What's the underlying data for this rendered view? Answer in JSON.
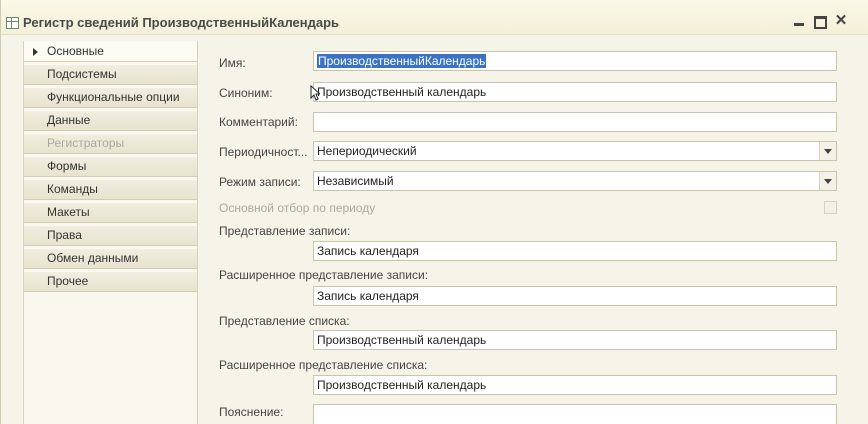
{
  "window": {
    "title": "Регистр сведений ПроизводственныйКалендарь",
    "controls": {
      "minimize": "_",
      "close": "✕"
    }
  },
  "sidebar": {
    "items": [
      {
        "label": "Основные",
        "state": "active"
      },
      {
        "label": "Подсистемы",
        "state": "normal"
      },
      {
        "label": "Функциональные опции",
        "state": "normal"
      },
      {
        "label": "Данные",
        "state": "normal"
      },
      {
        "label": "Регистраторы",
        "state": "disabled"
      },
      {
        "label": "Формы",
        "state": "normal"
      },
      {
        "label": "Команды",
        "state": "normal"
      },
      {
        "label": "Макеты",
        "state": "normal"
      },
      {
        "label": "Права",
        "state": "normal"
      },
      {
        "label": "Обмен данными",
        "state": "normal"
      },
      {
        "label": "Прочее",
        "state": "normal"
      }
    ]
  },
  "form": {
    "name_label": "Имя:",
    "name_value": "ПроизводственныйКалендарь",
    "synonym_label": "Синоним:",
    "synonym_value": "Производственный календарь",
    "comment_label": "Комментарий:",
    "comment_value": "",
    "periodicity_label": "Периодичност...",
    "periodicity_value": "Непериодический",
    "write_mode_label": "Режим записи:",
    "write_mode_value": "Независимый",
    "period_filter_label": "Основной отбор по периоду",
    "period_filter_checked": false,
    "record_presentation_label": "Представление записи:",
    "record_presentation_value": "Запись календаря",
    "ext_record_presentation_label": "Расширенное представление записи:",
    "ext_record_presentation_value": "Запись календаря",
    "list_presentation_label": "Представление списка:",
    "list_presentation_value": "Производственный календарь",
    "ext_list_presentation_label": "Расширенное представление списка:",
    "ext_list_presentation_value": "Производственный календарь",
    "explanation_label": "Пояснение:",
    "explanation_value": ""
  },
  "colors": {
    "selection": "#3a73c4",
    "window_bg": "#f6f4e9",
    "disabled_text": "#a9a9a0"
  }
}
